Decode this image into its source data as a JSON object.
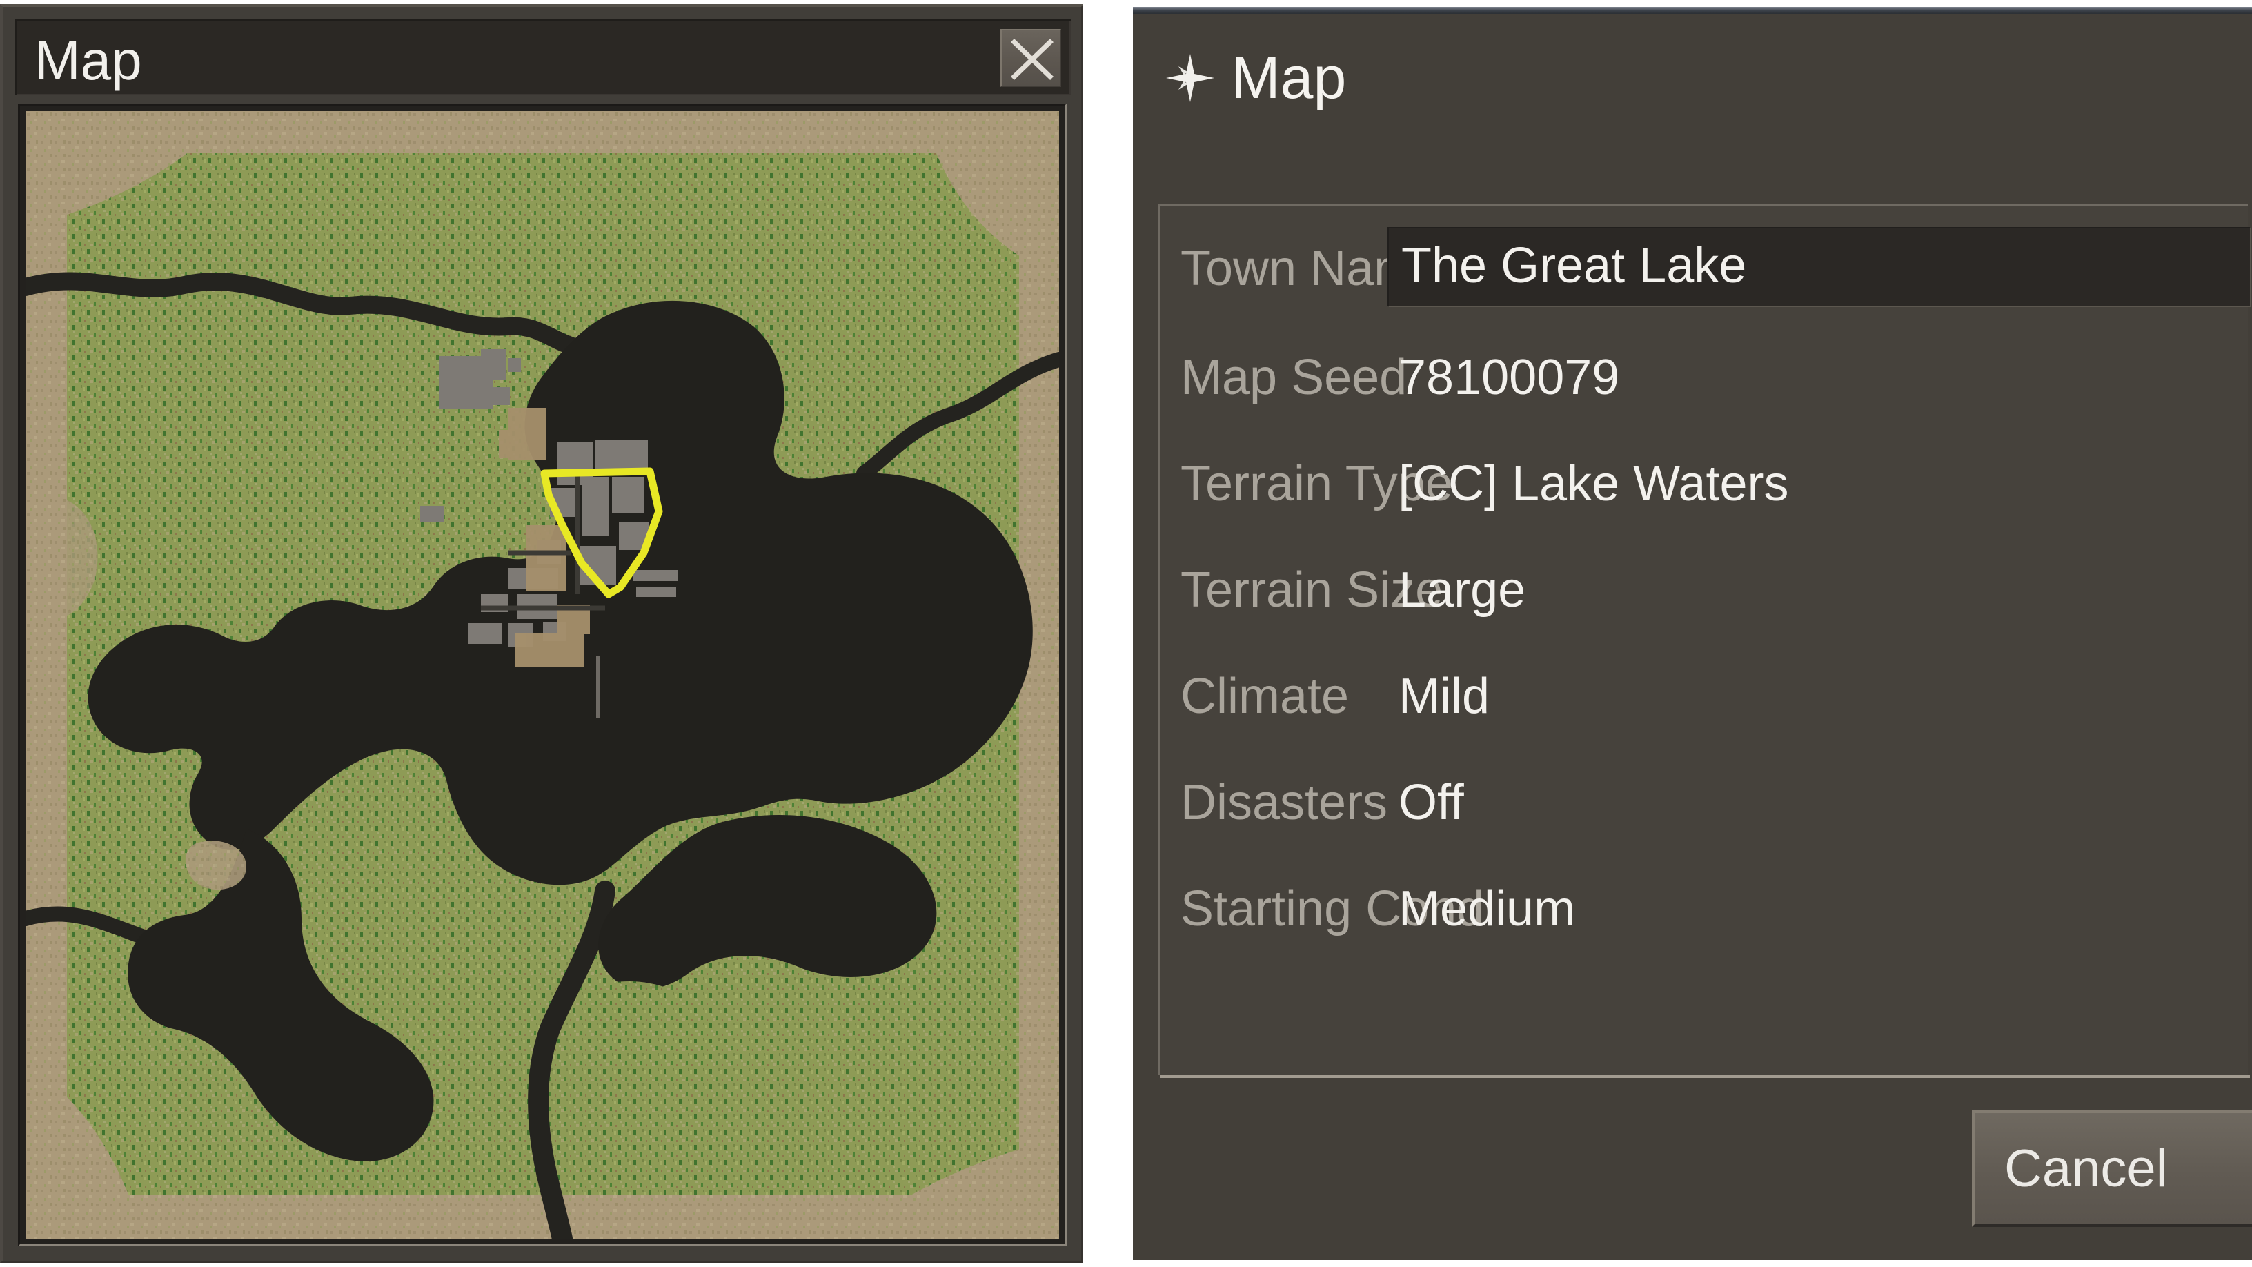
{
  "map_window": {
    "title": "Map",
    "close_icon": "close-x-icon",
    "minimap": {
      "land_color": "#8b9a52",
      "dirt_color": "#a99878",
      "water_color": "#22211d",
      "building_color": "#807c78",
      "boundary_color": "#e8e825",
      "tree_color": "#2f6b24",
      "border_color": "#8b857b"
    }
  },
  "settings_panel": {
    "header": {
      "icon": "compass-star-icon",
      "title": "Map"
    },
    "fields": [
      {
        "label": "Town Name",
        "value": "The Great Lake",
        "type": "text-input"
      },
      {
        "label": "Map Seed",
        "value": "78100079",
        "type": "static"
      },
      {
        "label": "Terrain Type",
        "value": "[CC] Lake Waters",
        "type": "static"
      },
      {
        "label": "Terrain Size",
        "value": "Large",
        "type": "static"
      },
      {
        "label": "Climate",
        "value": "Mild",
        "type": "static"
      },
      {
        "label": "Disasters",
        "value": "Off",
        "type": "static"
      },
      {
        "label": "Starting Cond",
        "value": "Medium",
        "type": "static"
      }
    ],
    "footer": {
      "cancel_label": "Cancel"
    }
  },
  "colors": {
    "panel_bg": "#433f39",
    "form_bg": "#46423c",
    "window_bg": "#413e39",
    "titlebar_bg": "#2b2824",
    "label_text": "#a9a49b",
    "value_text": "#f3f1ed",
    "input_bg": "#2b2825",
    "panel_outline": "#ffffff"
  }
}
